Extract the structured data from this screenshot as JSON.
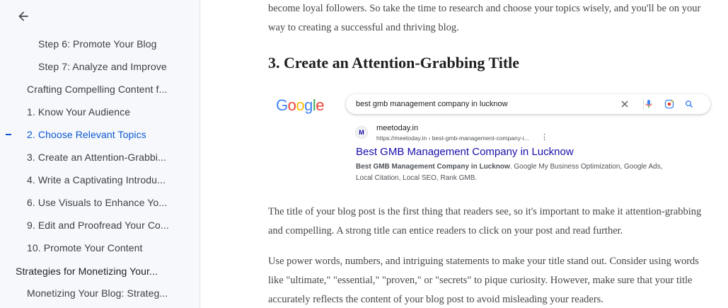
{
  "sidebar": {
    "back_label": "",
    "items": [
      {
        "label": "Step 6: Promote Your Blog",
        "level": 3,
        "active": false
      },
      {
        "label": "Step 7: Analyze and Improve",
        "level": 3,
        "active": false
      },
      {
        "label": "Crafting Compelling Content f...",
        "level": 2,
        "active": false
      },
      {
        "label": "1. Know Your Audience",
        "level": 2,
        "active": false
      },
      {
        "label": "2. Choose Relevant Topics",
        "level": 2,
        "active": true
      },
      {
        "label": "3. Create an Attention-Grabbi...",
        "level": 2,
        "active": false
      },
      {
        "label": "4. Write a Captivating Introdu...",
        "level": 2,
        "active": false
      },
      {
        "label": "6. Use Visuals to Enhance Yo...",
        "level": 2,
        "active": false
      },
      {
        "label": "9. Edit and Proofread Your Co...",
        "level": 2,
        "active": false
      },
      {
        "label": "10. Promote Your Content",
        "level": 2,
        "active": false
      },
      {
        "label": "Strategies for Monetizing Your...",
        "level": 1,
        "active": false
      },
      {
        "label": "Monetizing Your Blog: Strateg...",
        "level": 2,
        "active": false
      }
    ]
  },
  "document": {
    "intro_paragraph": "become loyal followers. So take the time to research and choose your topics wisely, and you'll be on your way to creating a successful and thriving blog.",
    "heading": "3. Create an Attention-Grabbing Title",
    "embed": {
      "logo": [
        "G",
        "o",
        "o",
        "g",
        "l",
        "e"
      ],
      "search_query": "best gmb management company in lucknow",
      "favicon_letter": "M",
      "site_name": "meetoday.in",
      "site_url": "https://meetoday.in › best-gmb-management-company-i...",
      "menu_glyph": "⋮",
      "result_title": "Best GMB Management Company in Lucknow",
      "snippet_bold": "Best GMB Management Company in Lucknow",
      "snippet_rest": ". Google My Business Optimization, Google Ads, Local Citation, Local SEO, Rank GMB."
    },
    "paragraph_2": "The title of your blog post is the first thing that readers see, so it's important to make it attention-grabbing and compelling. A strong title can entice readers to click on your post and read further.",
    "paragraph_3": "Use power words, numbers, and intriguing statements to make your title stand out. Consider using words like \"ultimate,\" \"essential,\" \"proven,\" or \"secrets\" to pique curiosity. However, make sure that your title accurately reflects the content of your blog post to avoid misleading your readers."
  },
  "colors": {
    "accent": "#0b57d0",
    "link": "#1a0dab",
    "sidebar_bg": "#f6f8fc"
  }
}
